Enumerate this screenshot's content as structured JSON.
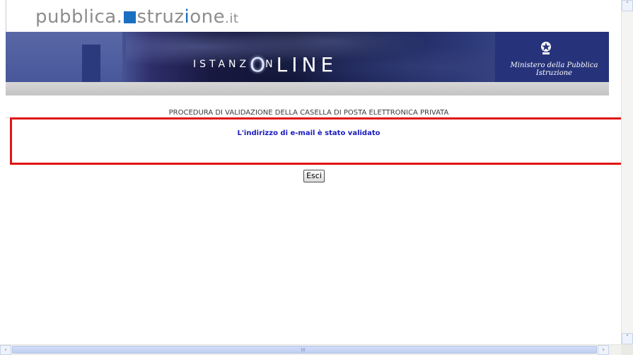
{
  "header": {
    "brand_prefix": "pubblica.",
    "brand_i": "i",
    "brand_mid": "struz",
    "brand_accent": "i",
    "brand_tail": "one",
    "brand_domain": ".it",
    "banner_pre": "ISTANZ",
    "banner_o": "O",
    "banner_post_small": "N",
    "banner_post": "LINE",
    "ministry": "Ministero della Pubblica Istruzione"
  },
  "page": {
    "procedure_title": "PROCEDURA DI VALIDAZIONE DELLA CASELLA DI POSTA ELETTRONICA PRIVATA",
    "message": "L'indirizzo di e-mail è stato validato",
    "exit_button": "Esci"
  },
  "scrollbars": {
    "left_arrow": "‹",
    "right_arrow": "›",
    "up_arrow": "˄",
    "down_arrow": "˅"
  },
  "colors": {
    "highlight_border": "#e01414",
    "message_text": "#1a1abe",
    "brand_blue": "#1a6fc1",
    "banner_navy": "#26337a"
  },
  "icons": [
    "emblem-icon",
    "left-arrow-icon",
    "right-arrow-icon",
    "up-arrow-icon",
    "down-arrow-icon"
  ]
}
